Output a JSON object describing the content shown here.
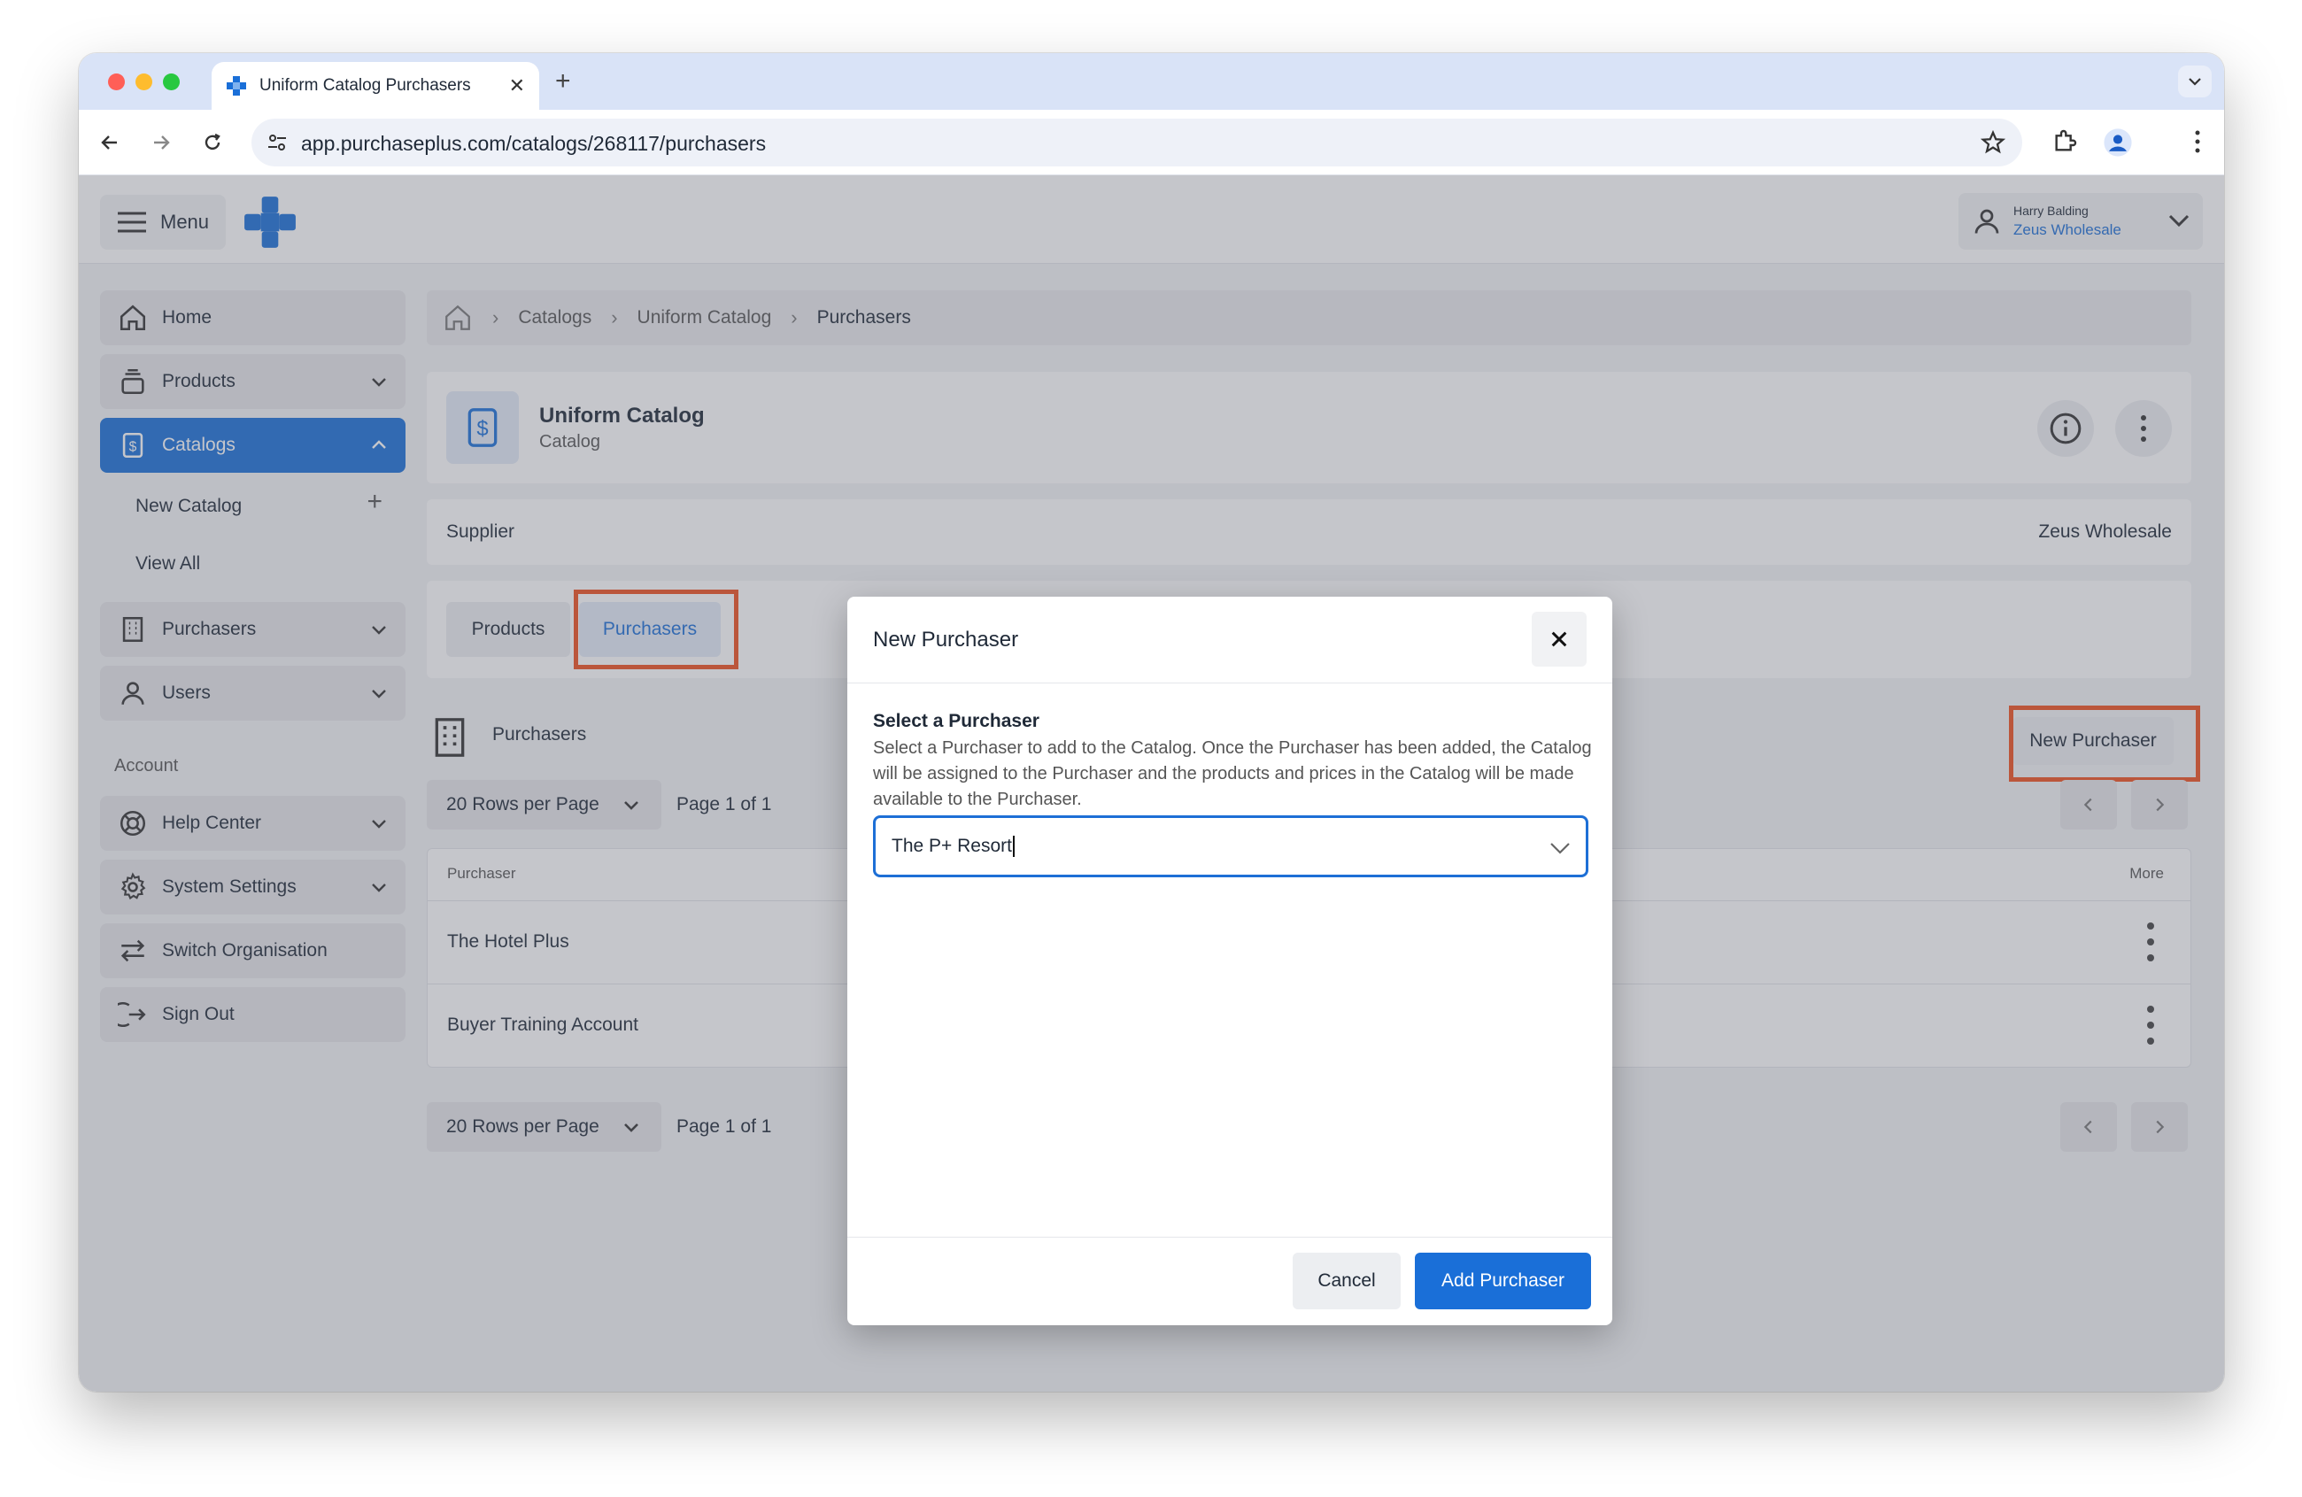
{
  "browser": {
    "tab_title": "Uniform Catalog Purchasers",
    "new_tab_symbol": "+",
    "url": "app.purchaseplus.com/catalogs/268117/purchasers"
  },
  "header": {
    "menu_label": "Menu",
    "user_name": "Harry Balding",
    "user_org": "Zeus Wholesale"
  },
  "sidebar": {
    "items": [
      {
        "label": "Home",
        "icon": "home-icon"
      },
      {
        "label": "Products",
        "icon": "products-icon"
      },
      {
        "label": "Catalogs",
        "icon": "catalog-icon"
      },
      {
        "label": "Purchasers",
        "icon": "building-icon"
      },
      {
        "label": "Users",
        "icon": "user-icon"
      }
    ],
    "catalog_sub": [
      "New Catalog",
      "View All"
    ],
    "account_label": "Account",
    "account_items": [
      {
        "label": "Help Center",
        "icon": "lifebuoy-icon"
      },
      {
        "label": "System Settings",
        "icon": "gear-icon"
      },
      {
        "label": "Switch Organisation",
        "icon": "switch-icon"
      },
      {
        "label": "Sign Out",
        "icon": "sign-out-icon"
      }
    ]
  },
  "breadcrumb": [
    "Catalogs",
    "Uniform Catalog",
    "Purchasers"
  ],
  "catalog": {
    "title": "Uniform Catalog",
    "subtitle": "Catalog",
    "supplier_label": "Supplier",
    "supplier_value": "Zeus Wholesale"
  },
  "tabs": [
    "Products",
    "Purchasers"
  ],
  "section": {
    "title": "Purchasers",
    "new_button": "New Purchaser"
  },
  "pagination": {
    "rows_per_page": "20 Rows per Page",
    "page_info": "Page 1 of 1"
  },
  "table": {
    "columns": [
      "Purchaser",
      "More"
    ],
    "rows": [
      "The Hotel Plus",
      "Buyer Training Account"
    ]
  },
  "modal": {
    "title": "New Purchaser",
    "field_label": "Select a Purchaser",
    "field_description": "Select a Purchaser to add to the Catalog. Once the Purchaser has been added, the Catalog will be assigned to the Purchaser and the products and prices in the Catalog will be made available to the Purchaser.",
    "selected_value": "The P+ Resort",
    "cancel_label": "Cancel",
    "submit_label": "Add Purchaser"
  },
  "colors": {
    "accent": "#1a6fd8",
    "highlight": "#f0501f"
  }
}
